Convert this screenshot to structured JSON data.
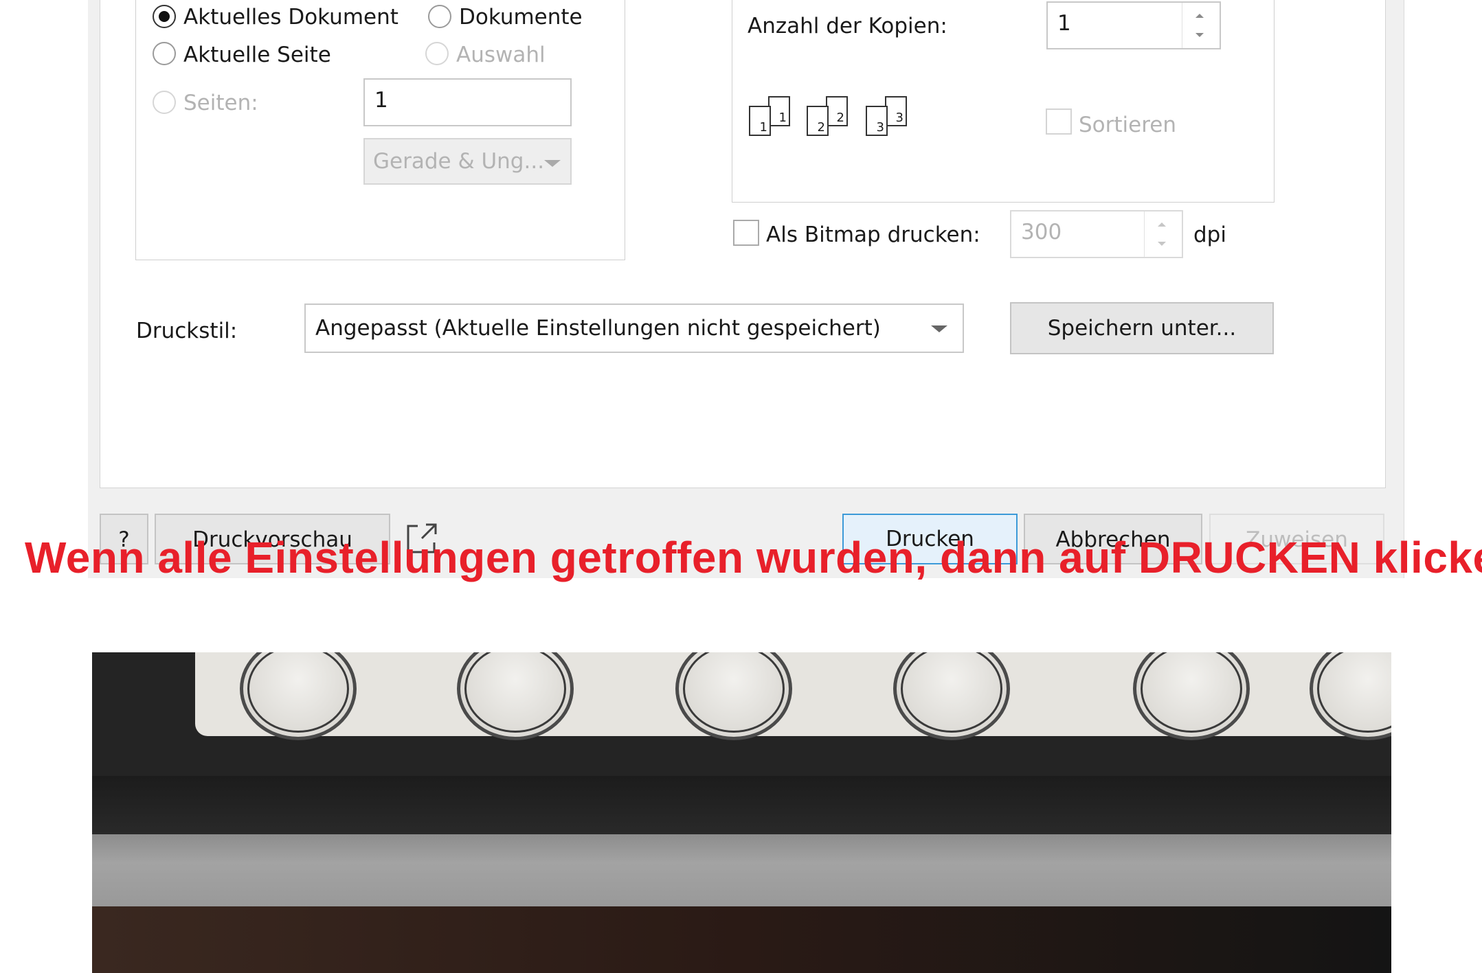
{
  "range": {
    "current_document": "Aktuelles Dokument",
    "documents": "Dokumente",
    "current_page": "Aktuelle Seite",
    "selection": "Auswahl",
    "pages_label": "Seiten:",
    "pages_value": "1",
    "even_odd": "Gerade & Ung..."
  },
  "copies": {
    "label": "Anzahl der Kopien:",
    "value": "1",
    "collate": "Sortieren",
    "collate_icon_pages": [
      "1",
      "1",
      "2",
      "2",
      "3",
      "3"
    ]
  },
  "bitmap": {
    "label": "Als Bitmap drucken:",
    "value": "300",
    "unit": "dpi"
  },
  "print_style": {
    "label": "Druckstil:",
    "value": "Angepasst (Aktuelle Einstellungen nicht gespeichert)",
    "save_as": "Speichern unter..."
  },
  "footer": {
    "help": "?",
    "preview": "Druckvorschau",
    "print": "Drucken",
    "cancel": "Abbrechen",
    "apply": "Zuweisen"
  },
  "banner": {
    "text": "Wenn alle Einstellungen getroffen wurden, dann auf DRUCKEN klicken"
  },
  "colors": {
    "banner": "#e8202a",
    "default_button_border": "#3c9ad8"
  }
}
